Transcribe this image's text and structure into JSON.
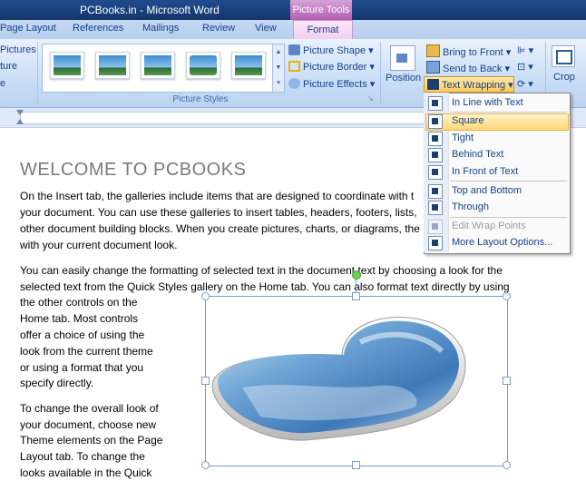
{
  "window": {
    "title": "PCBooks.in - Microsoft Word",
    "context_tab_group": "Picture Tools"
  },
  "tabs": [
    "Page Layout",
    "References",
    "Mailings",
    "Review",
    "View",
    "Format"
  ],
  "ribbon": {
    "left_partial": [
      "Pictures",
      "ture",
      "e"
    ],
    "gallery_label": "Picture Styles",
    "picture_shape": "Picture Shape",
    "picture_border": "Picture Border",
    "picture_effects": "Picture Effects",
    "position": "Position",
    "bring_to_front": "Bring to Front",
    "send_to_back": "Send to Back",
    "text_wrapping": "Text Wrapping",
    "crop": "Crop"
  },
  "menu": {
    "items": [
      {
        "label": "In Line with Text",
        "enabled": true
      },
      {
        "label": "Square",
        "enabled": true,
        "highlighted": true
      },
      {
        "label": "Tight",
        "enabled": true
      },
      {
        "label": "Behind Text",
        "enabled": true
      },
      {
        "label": "In Front of Text",
        "enabled": true
      },
      {
        "label": "Top and Bottom",
        "enabled": true
      },
      {
        "label": "Through",
        "enabled": true
      },
      {
        "label": "Edit Wrap Points",
        "enabled": false
      },
      {
        "label": "More Layout Options...",
        "enabled": true
      }
    ]
  },
  "document": {
    "heading": "WELCOME TO PCBOOKS",
    "para1": [
      "On the Insert tab, the galleries include items that are designed to coordinate with t",
      "your document. You can use these galleries to insert tables, headers, footers, lists,",
      "other document building blocks. When you create pictures, charts, or diagrams, the",
      "with your current document look."
    ],
    "para2": [
      "You can easily change the formatting of selected text in the document text by choosing a look for the",
      "selected text from the Quick Styles gallery on the Home tab. You can also format text directly by using",
      "the other controls on the",
      "Home tab. Most controls",
      "offer a choice of using the",
      "look from the current theme",
      "or using a format that you",
      "specify directly."
    ],
    "para3": [
      "To change the overall look of",
      "your document, choose new",
      "Theme elements on the Page",
      "Layout tab. To change the",
      "looks available in the Quick"
    ]
  },
  "colors": {
    "accent": "#15428b",
    "highlight": "#ffd775",
    "title_bar": "#1f4c8f",
    "context_tab": "#b15eb2"
  }
}
